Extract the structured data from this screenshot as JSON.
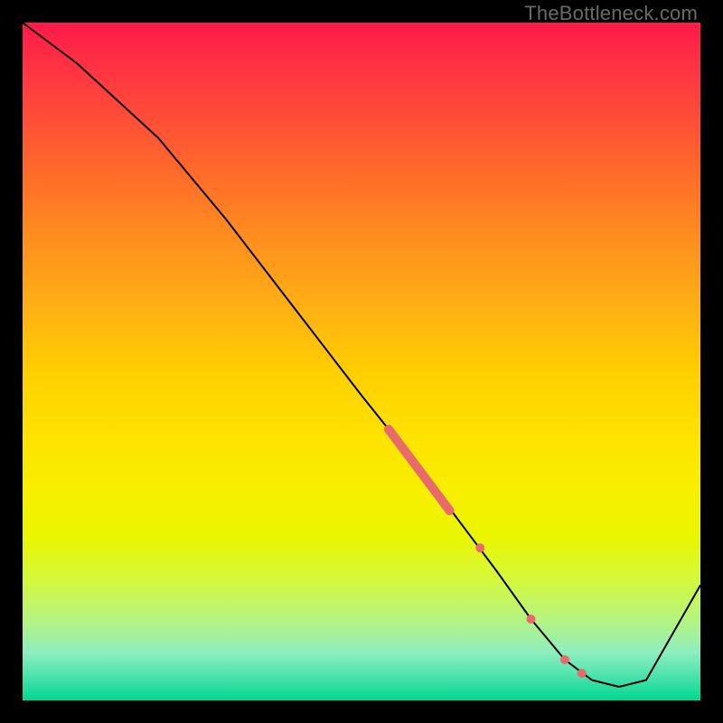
{
  "watermark": "TheBottleneck.com",
  "chart_data": {
    "type": "line",
    "title": "",
    "xlabel": "",
    "ylabel": "",
    "xlim": [
      0,
      100
    ],
    "ylim": [
      0,
      100
    ],
    "grid": false,
    "series": [
      {
        "name": "bottleneck-curve",
        "x": [
          0,
          8,
          20,
          30,
          40,
          50,
          58,
          64,
          70,
          75,
          80,
          84,
          88,
          92,
          100
        ],
        "y": [
          100,
          94,
          83,
          71,
          58,
          45,
          35,
          27,
          19,
          12,
          6,
          3,
          2,
          3,
          17
        ],
        "color": "#000000",
        "stroke_width": 2
      }
    ],
    "markers": [
      {
        "name": "thick-segment",
        "type": "line-segment",
        "x": [
          54,
          63
        ],
        "y": [
          40,
          28
        ],
        "color": "#e86a6a",
        "stroke_width": 10,
        "cap": "round"
      },
      {
        "name": "dot-a",
        "type": "dot",
        "x": 67.5,
        "y": 22.5,
        "r": 5,
        "color": "#e86a6a"
      },
      {
        "name": "dot-b",
        "type": "dot",
        "x": 75,
        "y": 12,
        "r": 5,
        "color": "#e86a6a"
      },
      {
        "name": "dot-c",
        "type": "dot",
        "x": 80,
        "y": 6,
        "r": 5,
        "color": "#e86a6a"
      },
      {
        "name": "dot-d",
        "type": "dot",
        "x": 82.5,
        "y": 4,
        "r": 5,
        "color": "#e86a6a"
      }
    ],
    "background": "red-yellow-green vertical gradient",
    "notes": "Values estimated from pixel positions; no axis ticks or labels are present in the source image."
  }
}
